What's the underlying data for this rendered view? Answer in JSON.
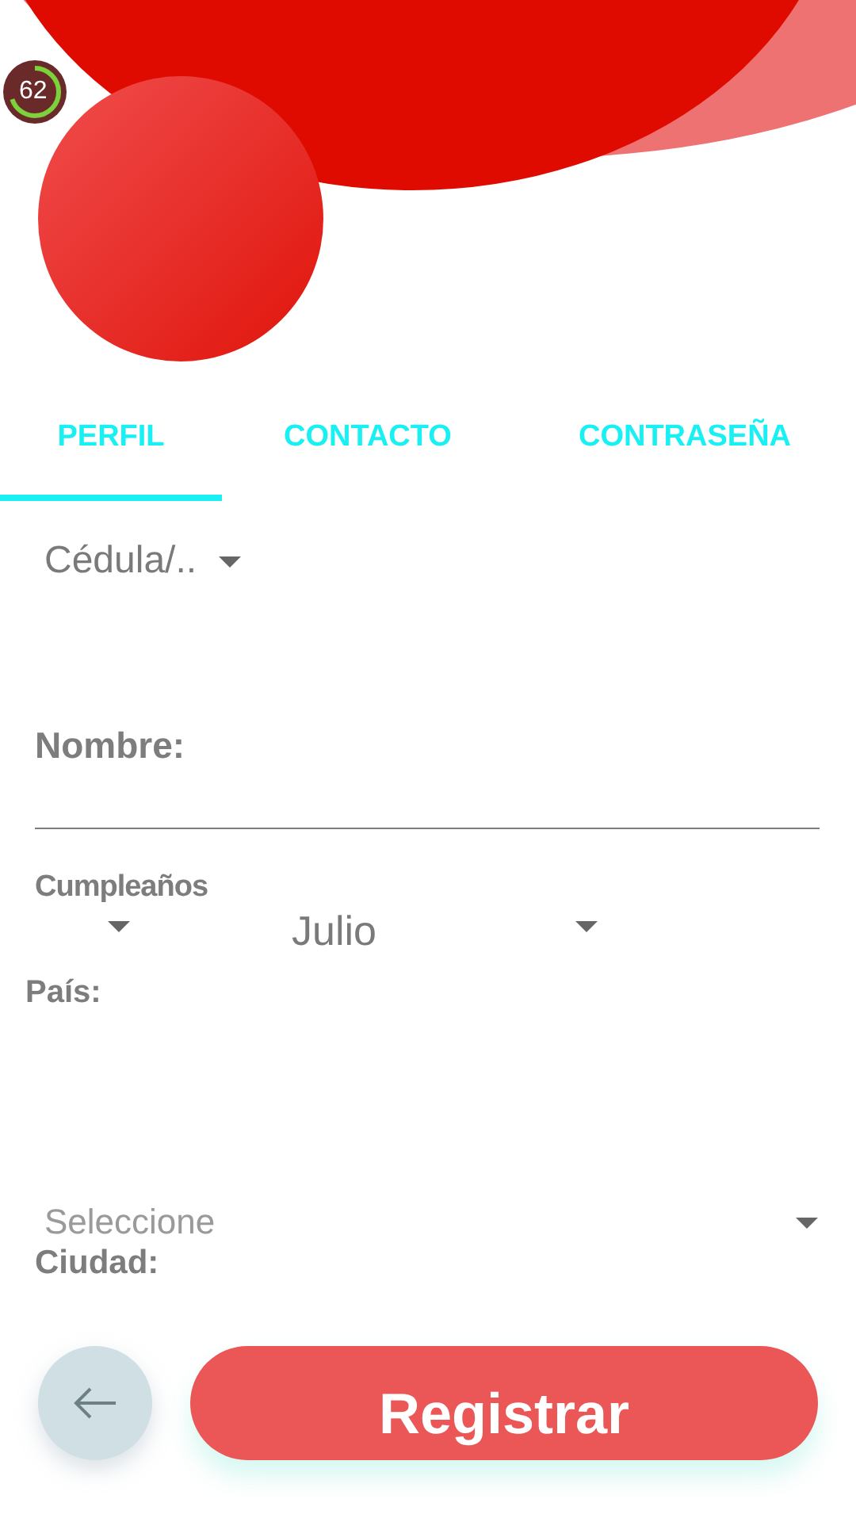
{
  "fps_badge": {
    "text": "62",
    "level": 0.7
  },
  "tabs": [
    {
      "label": "PERFIL",
      "selected": true
    },
    {
      "label": "CONTACTO",
      "selected": false
    },
    {
      "label": "CONTRASEÑA",
      "selected": false
    }
  ],
  "id_type": {
    "value": "Cédula/.."
  },
  "name_field": {
    "label": "Nombre:"
  },
  "birthday": {
    "label": "Cumpleaños",
    "month": "Julio"
  },
  "country": {
    "label": "País:",
    "value": "Seleccione"
  },
  "city": {
    "label": "Ciudad:"
  },
  "buttons": {
    "register": "Registrar"
  }
}
